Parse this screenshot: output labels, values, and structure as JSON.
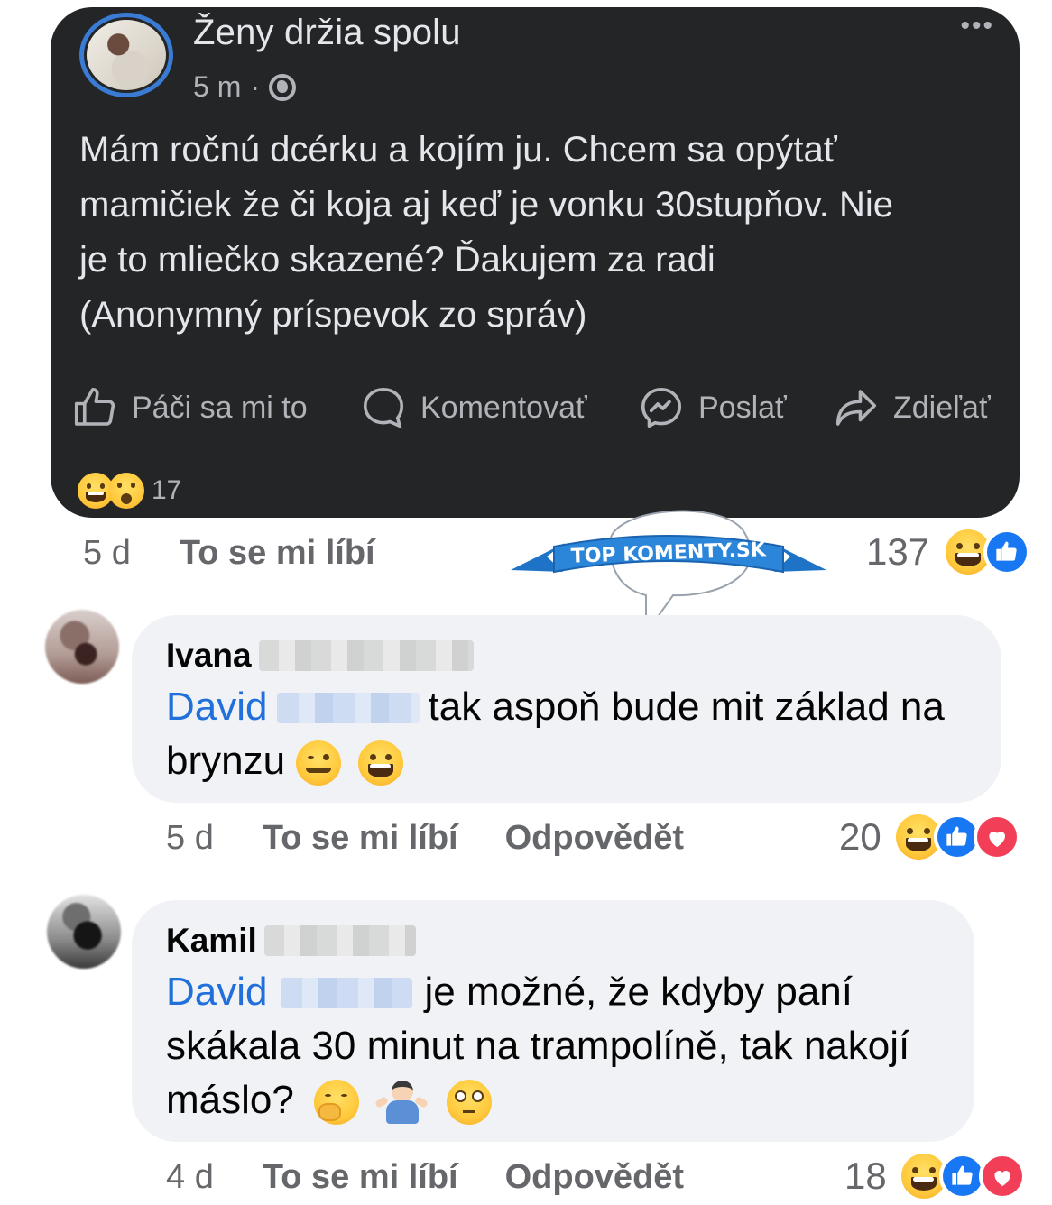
{
  "post": {
    "group_name": "Ženy držia spolu",
    "time": "5 m",
    "separator": "·",
    "more": "•••",
    "text_lines": [
      "Mám ročnú dcérku a kojím ju. Chcem sa opýtať",
      "mamičiek že či koja aj keď je vonku 30stupňov. Nie",
      "je to mliečko skazené? Ďakujem za radi",
      "(Anonymný príspevok zo správ)"
    ],
    "actions": {
      "like": "Páči sa mi to",
      "comment": "Komentovať",
      "send": "Poslať",
      "share": "Zdieľať"
    },
    "reaction_count": "17"
  },
  "post_footer": {
    "time": "5 d",
    "like": "To se mi líbí",
    "reaction_count": "137"
  },
  "watermark": "TOP KOMENTY.SK",
  "comments": [
    {
      "author": "Ivana",
      "mention": "David",
      "lines": [
        "tak aspoň bude mit základ na",
        "brynzu"
      ],
      "time": "5 d",
      "like": "To se mi líbí",
      "reply": "Odpovědět",
      "reaction_count": "20"
    },
    {
      "author": "Kamil",
      "mention": "David",
      "lines": [
        "je možné, že kdyby paní",
        "skákala 30 minut na trampolíně, tak nakojí",
        "máslo?"
      ],
      "time": "4 d",
      "like": "To se mi líbí",
      "reply": "Odpovědět",
      "reaction_count": "18"
    }
  ],
  "colors": {
    "post_bg": "#242526",
    "bubble_bg": "#f0f2f5",
    "mention": "#216fdb",
    "like_blue": "#1877f2",
    "love_red": "#f33e58"
  },
  "icons": [
    "globe-icon",
    "like-icon",
    "comment-icon",
    "messenger-icon",
    "share-icon",
    "haha-reaction-icon",
    "wow-reaction-icon",
    "like-reaction-icon",
    "love-reaction-icon"
  ]
}
